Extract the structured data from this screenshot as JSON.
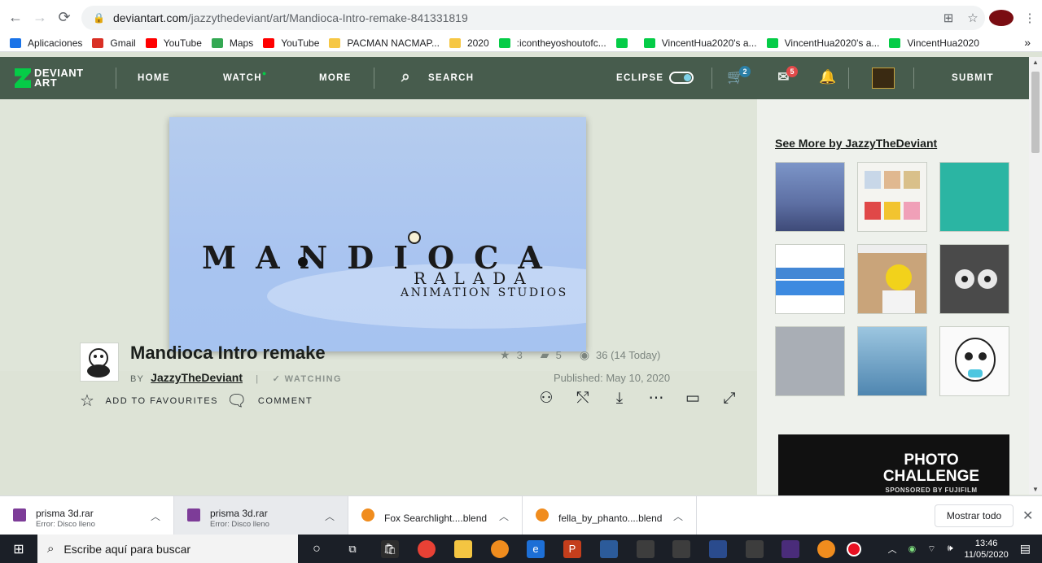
{
  "browser": {
    "url_host": "deviantart.com",
    "url_path": "/jazzythedeviant/art/Mandioca-Intro-remake-841331819",
    "bookmarks": [
      {
        "label": "Aplicaciones",
        "icon": "apps-grid-icon",
        "color": "#1a73e8"
      },
      {
        "label": "Gmail",
        "icon": "gmail-icon",
        "color": "#d93025"
      },
      {
        "label": "YouTube",
        "icon": "youtube-icon",
        "color": "#ff0000"
      },
      {
        "label": "Maps",
        "icon": "maps-icon",
        "color": "#34a853"
      },
      {
        "label": "YouTube",
        "icon": "youtube-icon",
        "color": "#ff0000"
      },
      {
        "label": "PACMAN NACMAP...",
        "icon": "folder-icon",
        "color": "#f6c744"
      },
      {
        "label": "2020",
        "icon": "folder-icon",
        "color": "#f6c744"
      },
      {
        "label": ":icontheyoshoutofc...",
        "icon": "deviantart-icon",
        "color": "#05cc47"
      },
      {
        "label": "",
        "icon": "deviantart-icon",
        "color": "#05cc47"
      },
      {
        "label": "VincentHua2020's a...",
        "icon": "deviantart-icon",
        "color": "#05cc47"
      },
      {
        "label": "VincentHua2020's a...",
        "icon": "deviantart-icon",
        "color": "#05cc47"
      },
      {
        "label": "VincentHua2020",
        "icon": "deviantart-icon",
        "color": "#05cc47"
      }
    ],
    "more": "»"
  },
  "header": {
    "logo_line1": "DEVIANT",
    "logo_line2": "ART",
    "home": "HOME",
    "watch": "WATCH",
    "more": "MORE",
    "search": "SEARCH",
    "eclipse": "ECLIPSE",
    "cart_badge": "2",
    "messages_badge": "5",
    "submit": "SUBMIT",
    "accent": "#05cc47"
  },
  "artwork": {
    "title_text": "MANDIOCA",
    "subtitle": "RALADA",
    "subtitle2": "ANIMATION STUDIOS"
  },
  "actions": {
    "favourite": "ADD TO FAVOURITES",
    "comment": "COMMENT"
  },
  "deviation": {
    "title": "Mandioca Intro remake",
    "by": "BY",
    "author": "JazzyTheDeviant",
    "watching": "✓ WATCHING",
    "favourites": "3",
    "comments": "5",
    "views": "36 (14 Today)",
    "published": "Published: May 10, 2020"
  },
  "sidebar": {
    "see_more": "See More by JazzyTheDeviant",
    "ad_title": "PHOTO CHALLENGE",
    "ad_sub": "SPONSORED BY FUJIFILM"
  },
  "downloads": {
    "items": [
      {
        "name": "prisma 3d.rar",
        "status": "Error: Disco lleno"
      },
      {
        "name": "prisma 3d.rar",
        "status": "Error: Disco lleno"
      },
      {
        "name": "Fox Searchlight....blend",
        "status": ""
      },
      {
        "name": "fella_by_phanto....blend",
        "status": ""
      }
    ],
    "show_all": "Mostrar todo"
  },
  "taskbar": {
    "search_placeholder": "Escribe aquí para buscar",
    "time": "13:46",
    "date": "11/05/2020"
  }
}
